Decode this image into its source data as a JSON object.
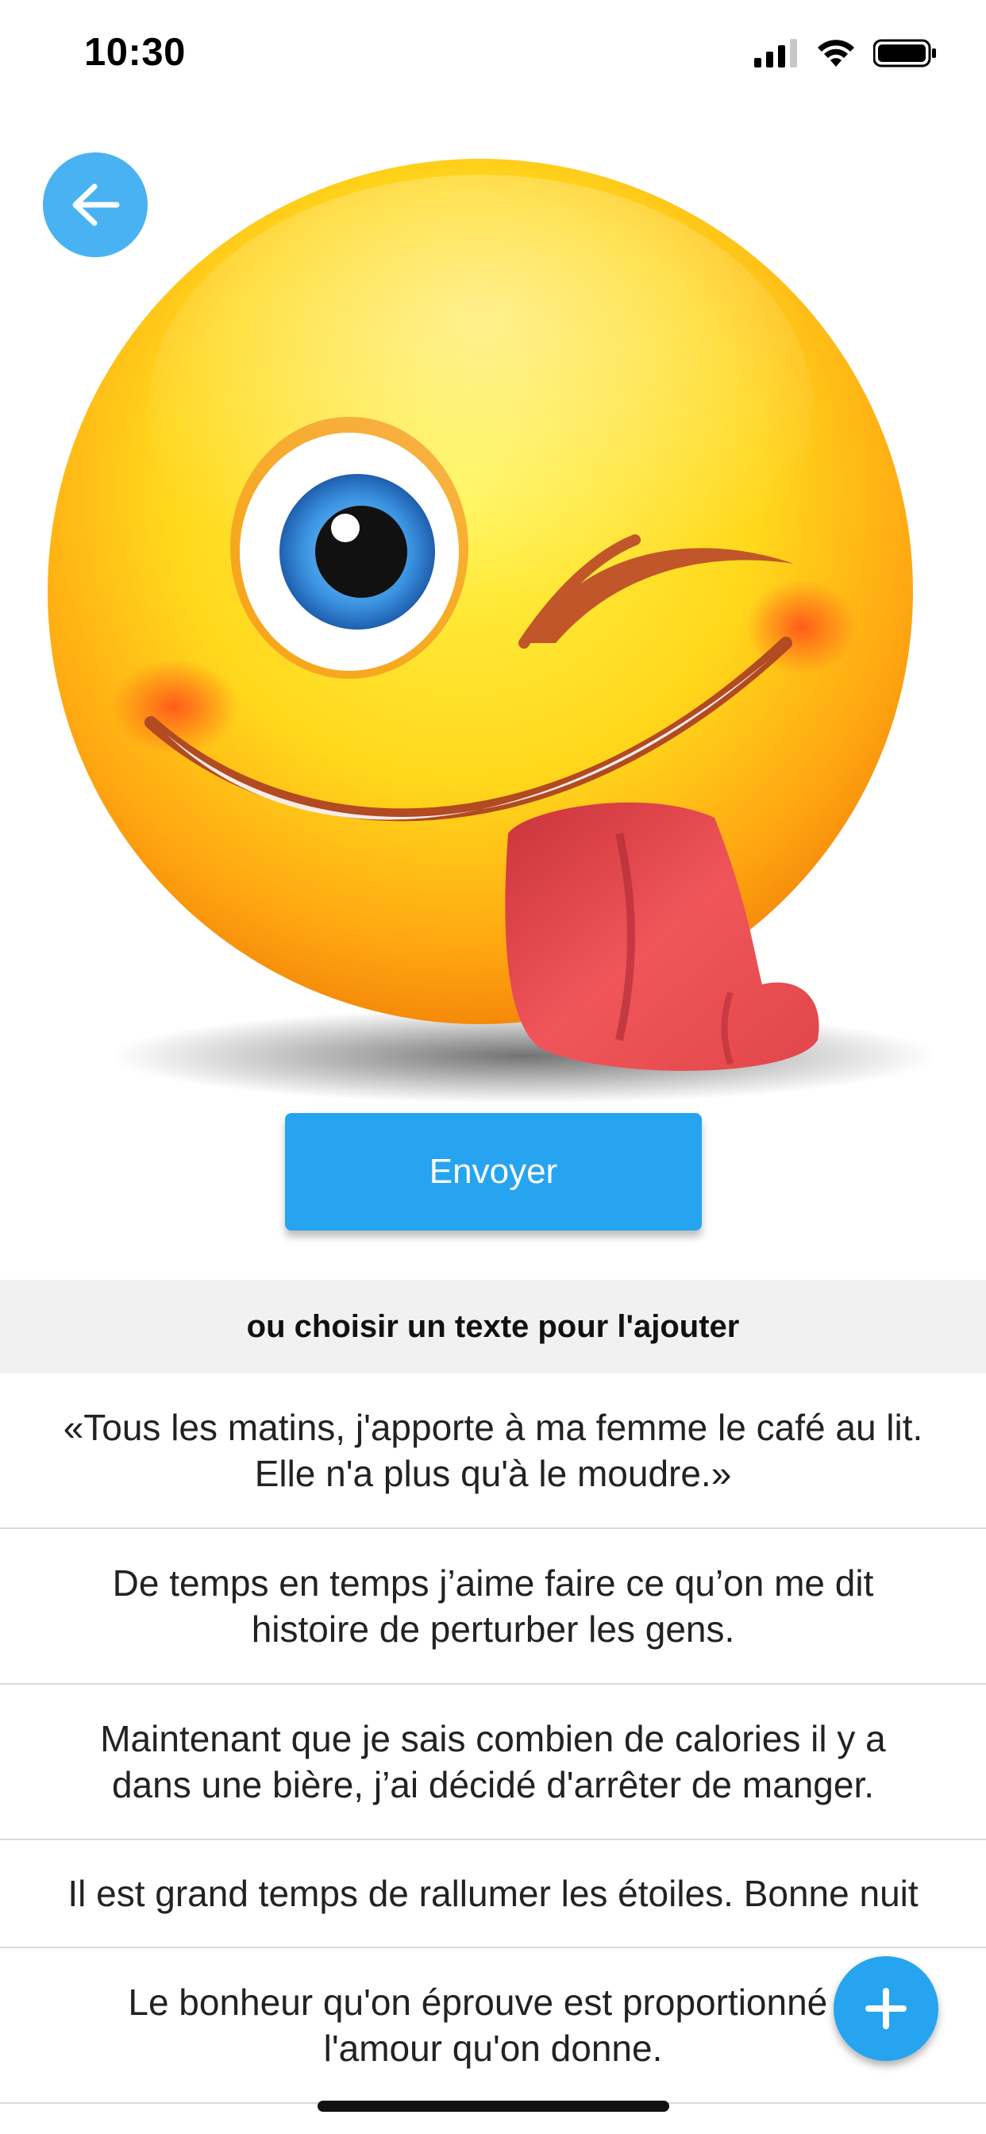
{
  "status_bar": {
    "time": "10:30"
  },
  "icons": {
    "back": "arrow-left-icon",
    "add": "plus-icon",
    "signal": "cellular-signal-icon",
    "wifi": "wifi-icon",
    "battery": "battery-icon"
  },
  "hero": {
    "emoji": "winking-face-with-tongue"
  },
  "actions": {
    "send_label": "Envoyer"
  },
  "section": {
    "header": "ou choisir un texte pour l'ajouter"
  },
  "quotes": [
    {
      "line1": "«Tous les matins, j'apporte à ma femme le café au lit.",
      "line2": "Elle n'a plus qu'à le moudre.»"
    },
    {
      "line1": "De temps en temps j’aime faire ce qu’on me dit",
      "line2": "histoire de perturber les gens."
    },
    {
      "line1": "Maintenant que je sais combien de calories il y a",
      "line2": "dans une bière, j’ai décidé d'arrêter de manger."
    },
    {
      "line1": "Il est grand temps de rallumer les étoiles. Bonne nuit"
    },
    {
      "line1": "Le bonheur qu'on éprouve est proportionné à",
      "line2": "l'amour qu'on donne."
    }
  ],
  "colors": {
    "accent": "#26a4ef",
    "back_button": "#49b2f2",
    "section_bg": "#f1f1f1"
  }
}
